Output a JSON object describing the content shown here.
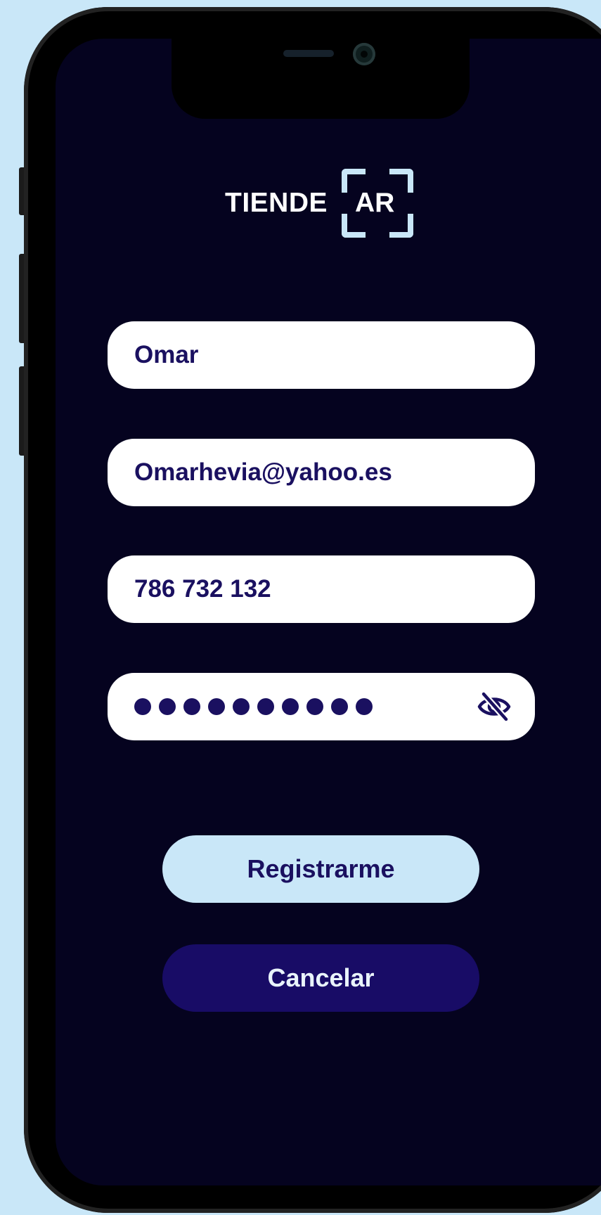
{
  "app": {
    "logo_text": "TIENDE",
    "logo_badge": "AR"
  },
  "form": {
    "name_value": "Omar",
    "email_value": "Omarhevia@yahoo.es",
    "phone_value": "786 732 132",
    "password_mask_count": 10,
    "password_visibility_icon": "eye-off-icon"
  },
  "actions": {
    "register_label": "Registrarme",
    "cancel_label": "Cancelar"
  },
  "colors": {
    "background": "#c9e7f8",
    "screen": "#05031f",
    "accent_light": "#c9e7f8",
    "accent_dark": "#180c66",
    "text_dark": "#1a1060"
  }
}
